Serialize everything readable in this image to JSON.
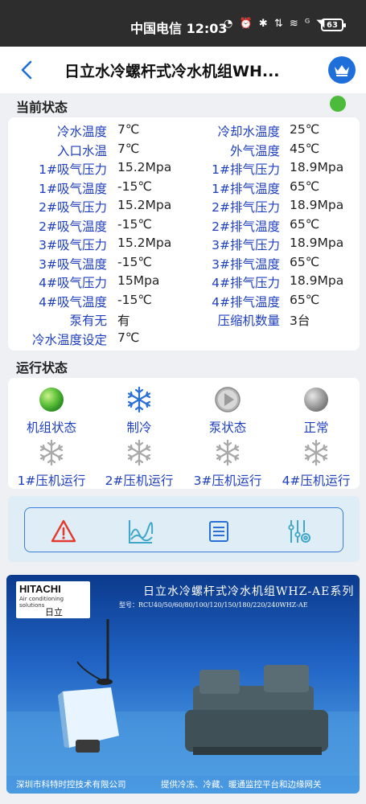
{
  "statusbar": {
    "carrier_time": "中国电信 12:03",
    "icons_text": "◔ ⏰ ✱ ⇅ ≋ ᴳ ◥",
    "battery": "63"
  },
  "header": {
    "title": "日立水冷螺杆式冷水机组WH..."
  },
  "current_status": {
    "label": "当前状态",
    "rows": [
      {
        "l1": "冷水温度",
        "v1": "7℃",
        "l2": "冷却水温度",
        "v2": "25℃"
      },
      {
        "l1": "入口水温",
        "v1": "7℃",
        "l2": "外气温度",
        "v2": "45℃"
      },
      {
        "l1": "1#吸气压力",
        "v1": "15.2Mpa",
        "l2": "1#排气压力",
        "v2": "18.9Mpa"
      },
      {
        "l1": "1#吸气温度",
        "v1": "-15℃",
        "l2": "1#排气温度",
        "v2": "65℃"
      },
      {
        "l1": "2#吸气压力",
        "v1": "15.2Mpa",
        "l2": "2#排气压力",
        "v2": "18.9Mpa"
      },
      {
        "l1": "2#吸气温度",
        "v1": "-15℃",
        "l2": "2#排气温度",
        "v2": "65℃"
      },
      {
        "l1": "3#吸气压力",
        "v1": "15.2Mpa",
        "l2": "3#排气压力",
        "v2": "18.9Mpa"
      },
      {
        "l1": "3#吸气温度",
        "v1": "-15℃",
        "l2": "3#排气温度",
        "v2": "65℃"
      },
      {
        "l1": "4#吸气压力",
        "v1": "15Mpa",
        "l2": "4#排气压力",
        "v2": "18.9Mpa"
      },
      {
        "l1": "4#吸气温度",
        "v1": "-15℃",
        "l2": "4#排气温度",
        "v2": "65℃"
      },
      {
        "l1": "泵有无",
        "v1": "有",
        "l2": "压缩机数量",
        "v2": "3台"
      },
      {
        "l1": "冷水温度设定",
        "v1": "7℃",
        "l2": "",
        "v2": ""
      }
    ]
  },
  "run_status": {
    "label": "运行状态",
    "items": [
      {
        "label": "机组状态",
        "icon": "green-ball-icon"
      },
      {
        "label": "制冷",
        "icon": "snowflake-icon"
      },
      {
        "label": "泵状态",
        "icon": "play-icon"
      },
      {
        "label": "正常",
        "icon": "gray-ball-icon"
      },
      {
        "label": "1#压机运行",
        "icon": "snowflake-icon"
      },
      {
        "label": "2#压机运行",
        "icon": "snowflake-icon"
      },
      {
        "label": "3#压机运行",
        "icon": "snowflake-icon"
      },
      {
        "label": "4#压机运行",
        "icon": "snowflake-icon"
      }
    ]
  },
  "toolbar": {
    "buttons": [
      "alarm-icon",
      "chart-icon",
      "list-icon",
      "settings-icon"
    ]
  },
  "banner": {
    "brand": "HITACHI",
    "brand_sub": "Air conditioning solutions",
    "brand_cn": "日立",
    "title": "日立水冷螺杆式冷水机组WHZ-AE系列",
    "model": "型号：RCU40/50/60/80/100/120/150/180/220/240WHZ-AE",
    "footer_left": "深圳市科特时控技术有限公司",
    "footer_right": "提供冷冻、冷藏、暖通监控平台和边缘网关"
  },
  "colors": {
    "accent": "#1e6fd9",
    "label_blue": "#1f3fbf",
    "ok_green": "#4cbb3c",
    "icon_blue": "#2a6fd6",
    "icon_gray": "#a8a8a8",
    "alarm_red": "#e23a2e"
  }
}
